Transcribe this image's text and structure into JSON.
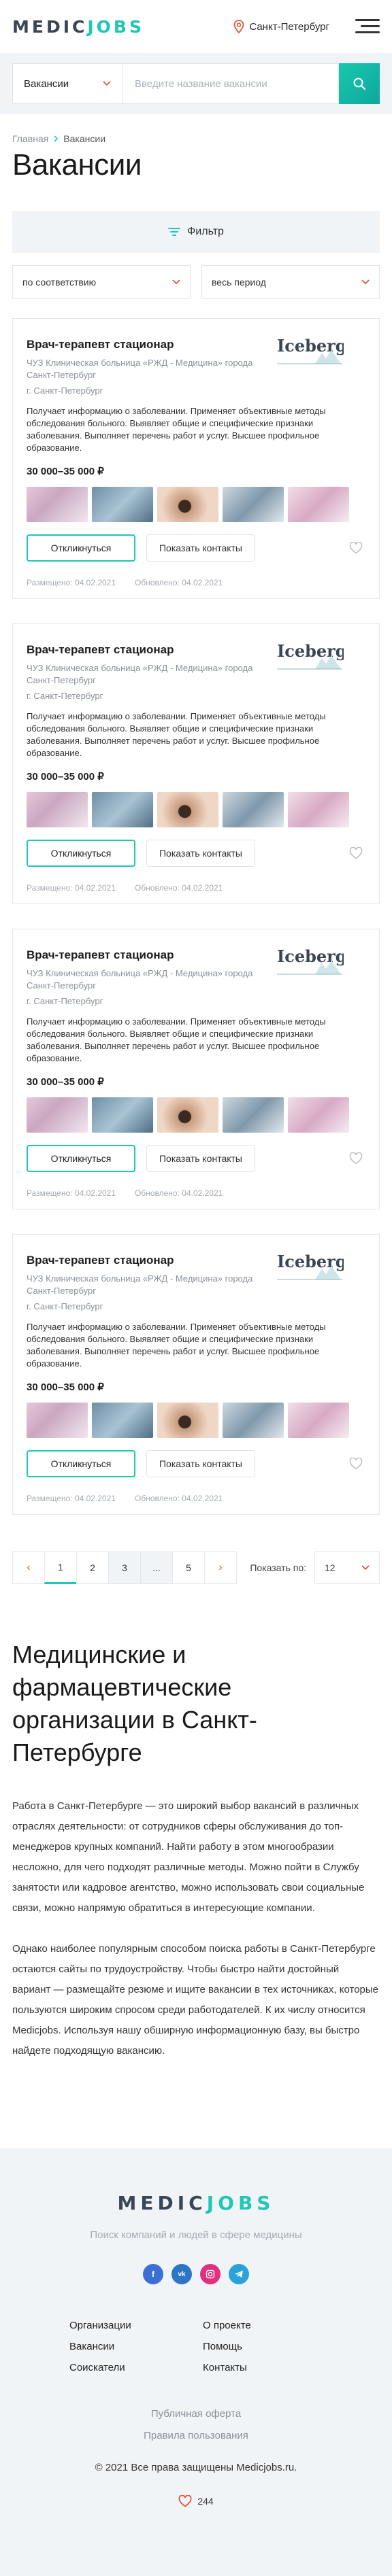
{
  "header": {
    "logo_part1": "MEDIC",
    "logo_part2": "JOBS",
    "city": "Санкт-Петербург",
    "icons": [
      "location-pin-icon",
      "burger-menu-icon"
    ]
  },
  "search": {
    "category": "Вакансии",
    "placeholder": "Введите название вакансии",
    "icon": "search-icon"
  },
  "breadcrumb": {
    "home": "Главная",
    "current": "Вакансии"
  },
  "page_title": "Вакансии",
  "filter_label": "Фильтр",
  "sort": {
    "order": "по соответствию",
    "period": "весь период"
  },
  "vacancies": [
    {
      "title": "Врач-терапевт стационар",
      "employer": "ЧУЗ Клиническая больница «РЖД - Медицина» города Санкт-Петербург",
      "city": "г. Санкт-Петербург",
      "description": "Получает информацию о заболевании. Применяет объективные методы обследования больного. Выявляет общие и специфические признаки заболевания. Выполняет перечень работ и услуг. Высшее профильное образование.",
      "salary": "30 000–35 000 ₽",
      "logo_text": "Iceberg",
      "respond_label": "Откликнуться",
      "contacts_label": "Показать контакты",
      "posted": "Размещено: 04.02.2021",
      "updated": "Обновлено: 04.02.2021"
    },
    {
      "title": "Врач-терапевт стационар",
      "employer": "ЧУЗ Клиническая больница «РЖД - Медицина» города Санкт-Петербург",
      "city": "г. Санкт-Петербург",
      "description": "Получает информацию о заболевании. Применяет объективные методы обследования больного. Выявляет общие и специфические признаки заболевания. Выполняет перечень работ и услуг. Высшее профильное образование.",
      "salary": "30 000–35 000 ₽",
      "logo_text": "Iceberg",
      "respond_label": "Откликнуться",
      "contacts_label": "Показать контакты",
      "posted": "Размещено: 04.02.2021",
      "updated": "Обновлено: 04.02.2021"
    },
    {
      "title": "Врач-терапевт стационар",
      "employer": "ЧУЗ Клиническая больница «РЖД - Медицина» города Санкт-Петербург",
      "city": "г. Санкт-Петербург",
      "description": "Получает информацию о заболевании. Применяет объективные методы обследования больного. Выявляет общие и специфические признаки заболевания. Выполняет перечень работ и услуг. Высшее профильное образование.",
      "salary": "30 000–35 000 ₽",
      "logo_text": "Iceberg",
      "respond_label": "Откликнуться",
      "contacts_label": "Показать контакты",
      "posted": "Размещено: 04.02.2021",
      "updated": "Обновлено: 04.02.2021"
    },
    {
      "title": "Врач-терапевт стационар",
      "employer": "ЧУЗ Клиническая больница «РЖД - Медицина» города Санкт-Петербург",
      "city": "г. Санкт-Петербург",
      "description": "Получает информацию о заболевании. Применяет объективные методы обследования больного. Выявляет общие и специфические признаки заболевания. Выполняет перечень работ и услуг. Высшее профильное образование.",
      "salary": "30 000–35 000 ₽",
      "logo_text": "Iceberg",
      "respond_label": "Откликнуться",
      "contacts_label": "Показать контакты",
      "posted": "Размещено: 04.02.2021",
      "updated": "Обновлено: 04.02.2021"
    }
  ],
  "pagination": {
    "pages": [
      "1",
      "2",
      "3",
      "...",
      "5"
    ],
    "current": "1",
    "per_page_label": "Показать по:",
    "per_page_value": "12"
  },
  "seo": {
    "title": "Медицинские и фармацевтические организации в Санкт-Петербурге",
    "paragraph1": "Работа в Санкт-Петербурге — это широкий выбор вакансий в различных отраслях деятельности: от сотрудников сферы обслуживания до топ-менеджеров крупных компаний. Найти работу в этом многообразии несложно, для чего подходят различные методы. Можно пойти в Службу занятости или кадровое агентство, можно использовать свои социальные связи, можно напрямую обратиться в интересующие компании.",
    "paragraph2": "Однако наиболее популярным способом поиска работы в Санкт-Петербурге остаются сайты по трудоустройству. Чтобы быстро найти достойный вариант — размещайте резюме и ищите вакансии в тех источниках, которые пользуются широким спросом среди работодателей. К их числу относится Medicjobs. Используя нашу обширную информационную базу, вы быстро найдете подходящую вакансию."
  },
  "footer": {
    "tagline": "Поиск компаний и людей в сфере медицины",
    "socials": [
      "facebook-icon",
      "vk-icon",
      "instagram-icon",
      "telegram-icon"
    ],
    "links": [
      "Организации",
      "О проекте",
      "Вакансии",
      "Помощь",
      "Соискатели",
      "Контакты"
    ],
    "offer": "Публичная оферта",
    "rules": "Правила пользования",
    "copyright": "© 2021 Все права защищены Medicjobs.ru.",
    "likes": "244"
  },
  "colors": {
    "accent": "#1fc7b4",
    "arrow": "#e5533d",
    "panel": "#f1f4f7"
  }
}
